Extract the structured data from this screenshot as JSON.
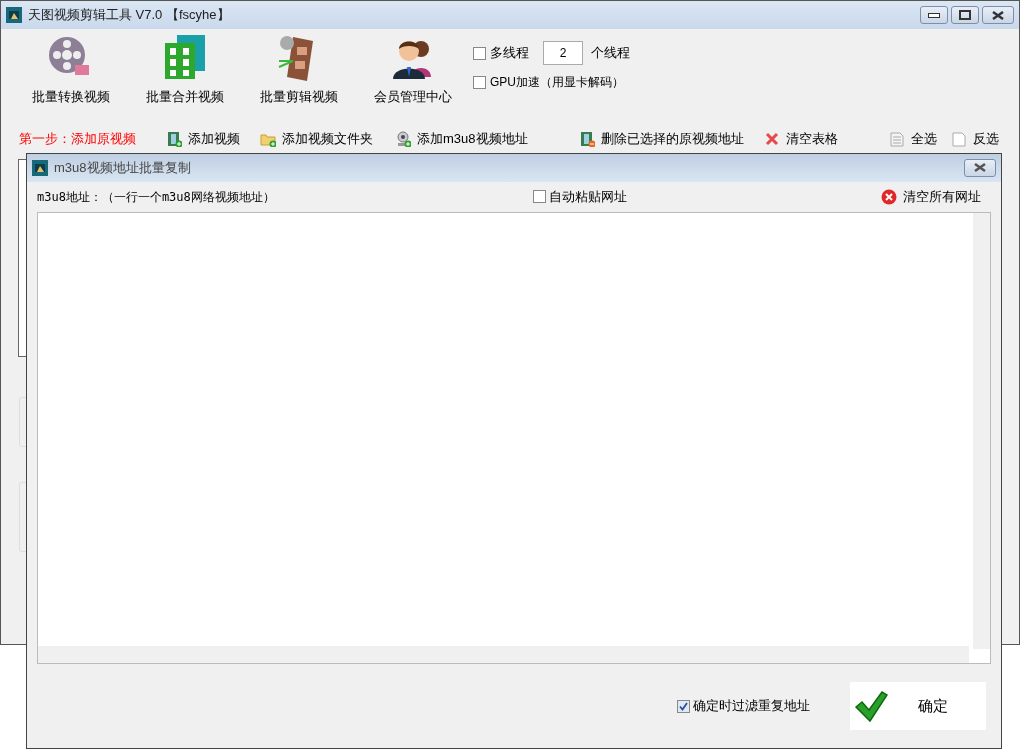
{
  "window": {
    "title": "天图视频剪辑工具 V7.0 【fscyhe】"
  },
  "tools": [
    {
      "label": "批量转换视频",
      "kind": "reel"
    },
    {
      "label": "批量合并视频",
      "kind": "merge"
    },
    {
      "label": "批量剪辑视频",
      "kind": "cut"
    },
    {
      "label": "会员管理中心",
      "kind": "members"
    }
  ],
  "options": {
    "multithread": {
      "label": "多线程",
      "checked": false
    },
    "thread_count": {
      "value": "2"
    },
    "thread_suffix": "个线程",
    "gpu": {
      "label": "GPU加速（用显卡解码）",
      "checked": false
    }
  },
  "step_label": "第一步：添加原视频",
  "actions": [
    {
      "label": "添加视频",
      "kind": "add-video"
    },
    {
      "label": "添加视频文件夹",
      "kind": "add-folder"
    },
    {
      "label": "添加m3u8视频地址",
      "kind": "add-url"
    },
    {
      "label": "删除已选择的原视频地址",
      "kind": "delete"
    },
    {
      "label": "清空表格",
      "kind": "clear"
    },
    {
      "label": "全选",
      "kind": "select-all"
    },
    {
      "label": "反选",
      "kind": "invert"
    }
  ],
  "dialog": {
    "title": "m3u8视频地址批量复制",
    "url_label": "m3u8地址：（一行一个m3u8网络视频地址）",
    "auto_paste": {
      "label": "自动粘贴网址",
      "checked": false
    },
    "clear_button": "清空所有网址",
    "filter_duplicates": {
      "label": "确定时过滤重复地址",
      "checked": true
    },
    "ok_button": "确定"
  }
}
